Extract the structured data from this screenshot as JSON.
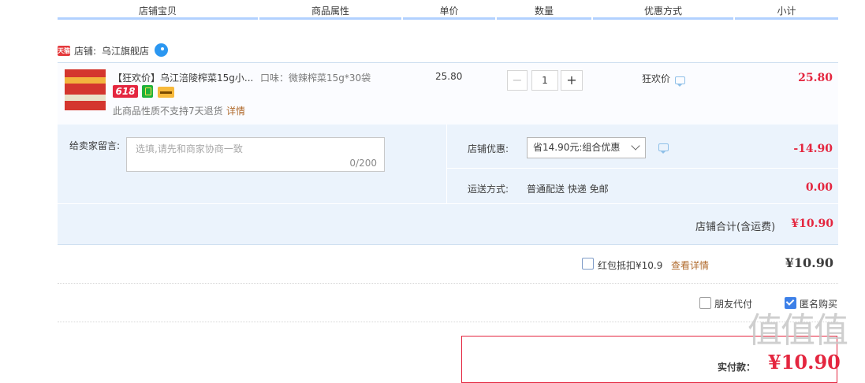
{
  "columns": [
    "店铺宝贝",
    "商品属性",
    "单价",
    "数量",
    "优惠方式",
    "小计"
  ],
  "shop": {
    "badge": "天猫",
    "label": "店铺:",
    "name": "乌江旗舰店"
  },
  "item": {
    "title": "【狂欢价】乌江涪陵榨菜15g小...",
    "promo_tag": "618",
    "attr": "口味：微辣榨菜15g*30袋",
    "price": "25.80",
    "quantity": "1",
    "minus": "−",
    "plus": "+",
    "discount_type": "狂欢价",
    "subtotal": "25.80",
    "return_note": "此商品性质不支持7天退货",
    "detail_link": "详情"
  },
  "message": {
    "label": "给卖家留言:",
    "placeholder": "选填,请先和商家协商一致",
    "counter": "0/200"
  },
  "shop_discount": {
    "label": "店铺优惠:",
    "selected": "省14.90元:组合优惠",
    "amount": "-14.90"
  },
  "shipping": {
    "label": "运送方式:",
    "value": "普通配送 快递 免邮",
    "amount": "0.00"
  },
  "shop_total": {
    "label": "店铺合计(含运费)",
    "amount": "¥10.90"
  },
  "red_packet": {
    "label": "红包抵扣¥10.9",
    "link": "查看详情",
    "total": "¥10.90",
    "checked": false
  },
  "options": {
    "friend_pay": "朋友代付",
    "anonymous": "匿名购买"
  },
  "payment": {
    "label": "实付款：",
    "amount": "¥10.90"
  },
  "watermark": "值值值",
  "colors": {
    "accent_red": "#e4263f",
    "header_border": "#b2d1ff",
    "panel_bg": "#ebf3fc",
    "link_orange": "#b06a2c"
  }
}
